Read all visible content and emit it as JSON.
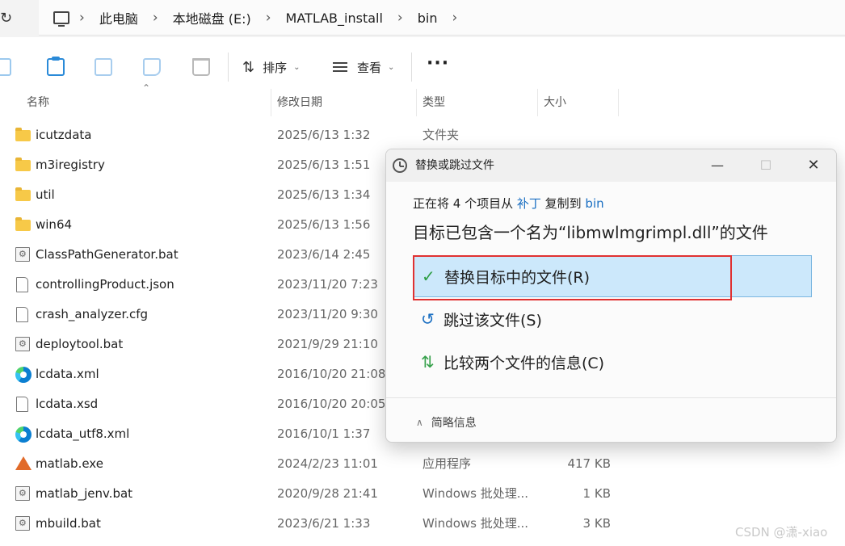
{
  "address": {
    "refresh_glyph": "↻",
    "separator": "›",
    "crumbs": [
      "此电脑",
      "本地磁盘 (E:)",
      "MATLAB_install",
      "bin"
    ]
  },
  "toolbar": {
    "sort_label": "排序",
    "sort_glyph": "⇅",
    "view_label": "查看",
    "chevron": "⌄",
    "more_label": "···"
  },
  "columns": {
    "name": "名称",
    "modified": "修改日期",
    "type": "类型",
    "size": "大小",
    "sort_caret": "⌃"
  },
  "files": [
    {
      "name": "icutzdata",
      "date": "2025/6/13 1:32",
      "type": "文件夹",
      "size": "",
      "icon": "folder"
    },
    {
      "name": "m3iregistry",
      "date": "2025/6/13 1:51",
      "type": "",
      "size": "",
      "icon": "folder"
    },
    {
      "name": "util",
      "date": "2025/6/13 1:34",
      "type": "",
      "size": "",
      "icon": "folder"
    },
    {
      "name": "win64",
      "date": "2025/6/13 1:56",
      "type": "",
      "size": "",
      "icon": "folder"
    },
    {
      "name": "ClassPathGenerator.bat",
      "date": "2023/6/14 2:45",
      "type": "",
      "size": "",
      "icon": "bat"
    },
    {
      "name": "controllingProduct.json",
      "date": "2023/11/20 7:23",
      "type": "",
      "size": "",
      "icon": "file"
    },
    {
      "name": "crash_analyzer.cfg",
      "date": "2023/11/20 9:30",
      "type": "",
      "size": "",
      "icon": "file"
    },
    {
      "name": "deploytool.bat",
      "date": "2021/9/29 21:10",
      "type": "",
      "size": "",
      "icon": "bat"
    },
    {
      "name": "lcdata.xml",
      "date": "2016/10/20 21:08",
      "type": "",
      "size": "",
      "icon": "edge"
    },
    {
      "name": "lcdata.xsd",
      "date": "2016/10/20 20:05",
      "type": "",
      "size": "",
      "icon": "file"
    },
    {
      "name": "lcdata_utf8.xml",
      "date": "2016/10/1 1:37",
      "type": "",
      "size": "",
      "icon": "edge"
    },
    {
      "name": "matlab.exe",
      "date": "2024/2/23 11:01",
      "type": "应用程序",
      "size": "417 KB",
      "icon": "matlab"
    },
    {
      "name": "matlab_jenv.bat",
      "date": "2020/9/28 21:41",
      "type": "Windows 批处理...",
      "size": "1 KB",
      "icon": "bat"
    },
    {
      "name": "mbuild.bat",
      "date": "2023/6/21 1:33",
      "type": "Windows 批处理...",
      "size": "3 KB",
      "icon": "bat"
    }
  ],
  "dialog": {
    "title": "替换或跳过文件",
    "btn_minimize": "—",
    "btn_maximize": "☐",
    "btn_close": "✕",
    "status_prefix": "正在将 4 个项目从 ",
    "status_source": "补丁",
    "status_middle": " 复制到 ",
    "status_dest": "bin",
    "heading": "目标已包含一个名为“libmwlmgrimpl.dll”的文件",
    "options": [
      {
        "glyph": "✓",
        "label": "替换目标中的文件(R)"
      },
      {
        "glyph": "↺",
        "label": "跳过该文件(S)"
      },
      {
        "glyph": "⇅",
        "label": "比较两个文件的信息(C)"
      }
    ],
    "details_caret": "∧",
    "details_label": "简略信息"
  },
  "watermark": "CSDN @潇-xiao"
}
